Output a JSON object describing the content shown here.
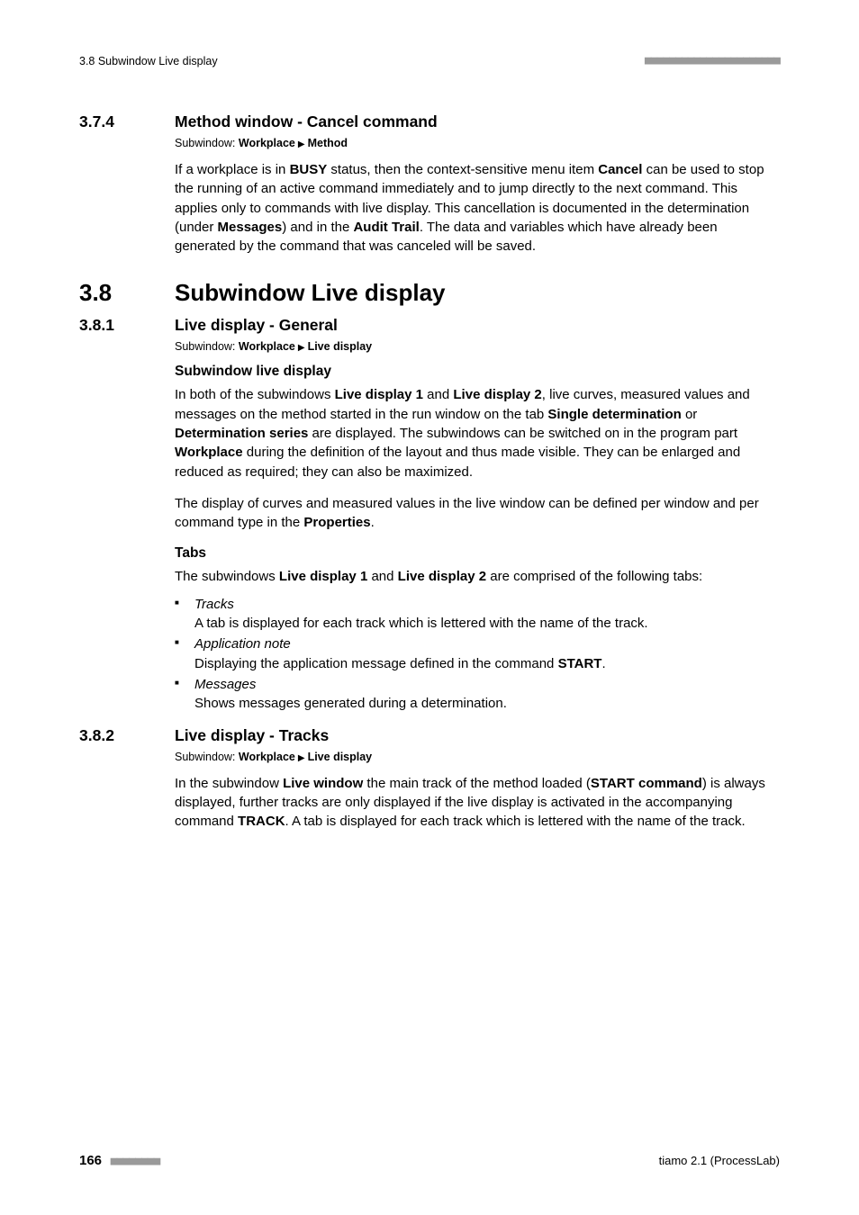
{
  "runhead": {
    "left": "3.8 Subwindow Live display",
    "dashes": "■■■■■■■■■■■■■■■■■■■■■■"
  },
  "s374": {
    "num": "3.7.4",
    "title": "Method window - Cancel command",
    "crumb_prefix": "Subwindow: ",
    "crumb_a": "Workplace",
    "crumb_b": "Method",
    "p1a": "If a workplace is in ",
    "p1_busy": "BUSY",
    "p1b": " status, then the context-sensitive menu item ",
    "p1_cancel": "Cancel",
    "p1c": " can be used to stop the running of an active command immediately and to jump directly to the next command. This applies only to commands with live display. This cancellation is documented in the determination (under ",
    "p1_messages": "Messages",
    "p1d": ") and in the ",
    "p1_audit": "Audit Trail",
    "p1e": ". The data and variables which have already been generated by the command that was canceled will be saved."
  },
  "s38": {
    "num": "3.8",
    "title": "Subwindow Live display"
  },
  "s381": {
    "num": "3.8.1",
    "title": "Live display - General",
    "crumb_prefix": "Subwindow: ",
    "crumb_a": "Workplace",
    "crumb_b": "Live display",
    "sub1": "Subwindow live display",
    "p1a": "In both of the subwindows ",
    "p1_ld1": "Live display 1",
    "p1b": " and ",
    "p1_ld2": "Live display 2",
    "p1c": ", live curves, measured values and messages on the method started in the run window on the tab ",
    "p1_sd": "Single determination",
    "p1d": " or ",
    "p1_ds": "Determination series",
    "p1e": " are displayed. The subwindows can be switched on in the program part ",
    "p1_wp": "Workplace",
    "p1f": " during the definition of the layout and thus made visible. They can be enlarged and reduced as required; they can also be maximized.",
    "p2a": "The display of curves and measured values in the live window can be defined per window and per command type in the ",
    "p2_props": "Properties",
    "p2b": ".",
    "sub2": "Tabs",
    "p3a": "The subwindows ",
    "p3_ld1": "Live display 1",
    "p3b": " and ",
    "p3_ld2": "Live display 2",
    "p3c": " are comprised of the following tabs:",
    "li1_t": "Tracks",
    "li1_d": "A tab is displayed for each track which is lettered with the name of the track.",
    "li2_t": "Application note",
    "li2_da": "Displaying the application message defined in the command ",
    "li2_start": "START",
    "li2_db": ".",
    "li3_t": "Messages",
    "li3_d": "Shows messages generated during a determination."
  },
  "s382": {
    "num": "3.8.2",
    "title": "Live display - Tracks",
    "crumb_prefix": "Subwindow: ",
    "crumb_a": "Workplace",
    "crumb_b": "Live display",
    "p1a": "In the subwindow ",
    "p1_lw": "Live window",
    "p1b": " the main track of the method loaded (",
    "p1_sc": "START command",
    "p1c": ") is always displayed, further tracks are only displayed if the live display is activated in the accompanying command ",
    "p1_track": "TRACK",
    "p1d": ". A tab is displayed for each track which is lettered with the name of the track."
  },
  "footer": {
    "pagenum": "166",
    "footdash": "■■■■■■■■",
    "right": "tiamo 2.1 (ProcessLab)"
  }
}
